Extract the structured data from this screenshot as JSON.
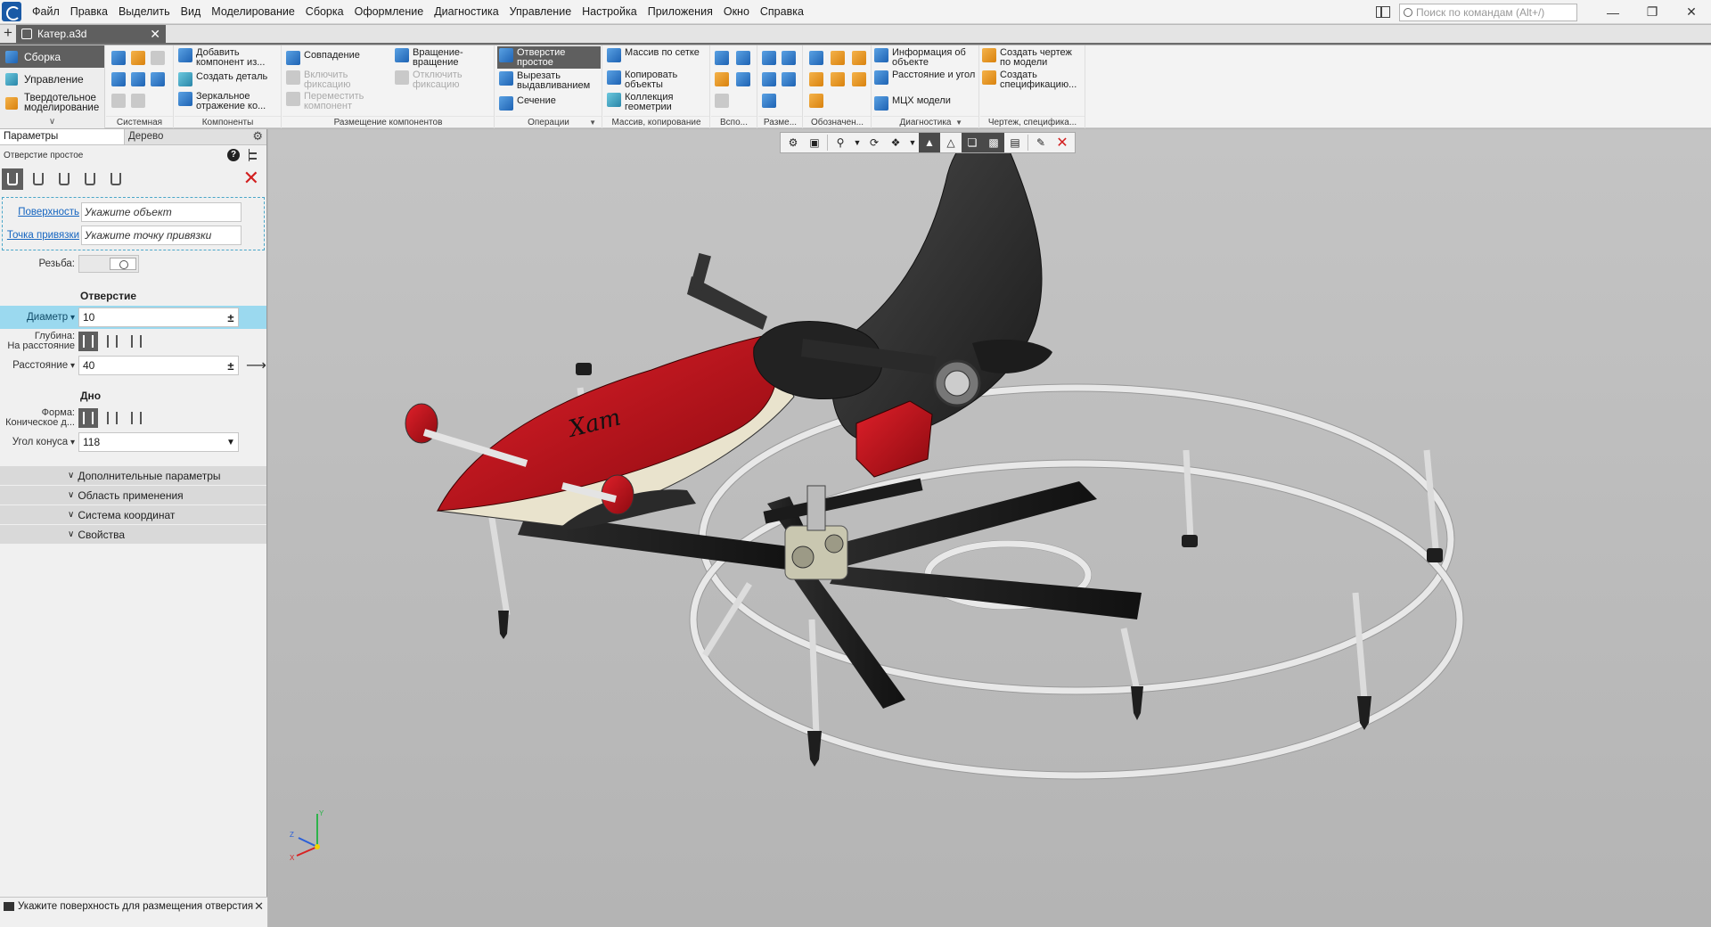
{
  "menubar": {
    "items": [
      "Файл",
      "Правка",
      "Выделить",
      "Вид",
      "Моделирование",
      "Сборка",
      "Оформление",
      "Диагностика",
      "Управление",
      "Настройка",
      "Приложения",
      "Окно",
      "Справка"
    ],
    "search_placeholder": "Поиск по командам (Alt+/)"
  },
  "doc_tab": {
    "label": "Катер.a3d"
  },
  "ribbon": {
    "modes": [
      {
        "label": "Сборка",
        "icon": "assembly-icon",
        "active": true
      },
      {
        "label": "Управление",
        "icon": "management-icon"
      },
      {
        "label": "Твердотельное моделирование",
        "icon": "solid-modeling-icon"
      }
    ],
    "groups": {
      "system": "Системная",
      "components": "Компоненты",
      "placement": "Размещение компонентов",
      "operations": "Операции",
      "array": "Массив, копирование",
      "aux": "Вспо...",
      "dims": "Разме...",
      "notation": "Обозначен...",
      "diagnostics": "Диагностика",
      "drawing": "Чертеж, специфика..."
    },
    "buttons": {
      "add_component": "Добавить компонент из...",
      "create_part": "Создать деталь",
      "mirror": "Зеркальное отражение ко...",
      "coincidence": "Совпадение",
      "enable_fix": "Включить фиксацию",
      "move_component": "Переместить компонент",
      "rotation": "Вращение-вращение",
      "disable_fix": "Отключить фиксацию",
      "simple_hole": "Отверстие простое",
      "cut_extrude": "Вырезать выдавливанием",
      "section": "Сечение",
      "grid_array": "Массив по сетке",
      "copy_objects": "Копировать объекты",
      "geometry_collection": "Коллекция геометрии",
      "object_info": "Информация об объекте",
      "distance_angle": "Расстояние и угол",
      "mass_props": "МЦХ модели",
      "create_drawing": "Создать чертеж по модели",
      "create_spec": "Создать спецификацию..."
    }
  },
  "panel": {
    "tabs": [
      "Параметры",
      "Дерево"
    ],
    "command_title": "Отверстие простое",
    "surface_label": "Поверхность",
    "surface_placeholder": "Укажите объект",
    "anchor_label": "Точка привязки",
    "anchor_placeholder": "Укажите точку привязки",
    "thread_label": "Резьба:",
    "section_hole": "Отверстие",
    "diameter_label": "Диаметр",
    "diameter_value": "10",
    "depth_label": "Глубина:",
    "depth_mode": "На расстояние",
    "distance_label": "Расстояние",
    "distance_value": "40",
    "section_bottom": "Дно",
    "shape_label": "Форма:",
    "shape_mode": "Коническое д...",
    "cone_angle_label": "Угол конуса",
    "cone_angle_value": "118",
    "collapsibles": [
      "Дополнительные параметры",
      "Область применения",
      "Система координат",
      "Свойства"
    ],
    "status_text": "Укажите поверхность для размещения отверстия"
  },
  "viewport": {
    "background": "#bdbdbd",
    "model_brand": "Хат",
    "model_colors": {
      "hull_red": "#c8101a",
      "seat": "#2b2b2b",
      "hull_cream": "#e9e3cd",
      "frame": "#e6e6e6"
    },
    "triad_labels": [
      "X",
      "Y",
      "Z"
    ]
  }
}
